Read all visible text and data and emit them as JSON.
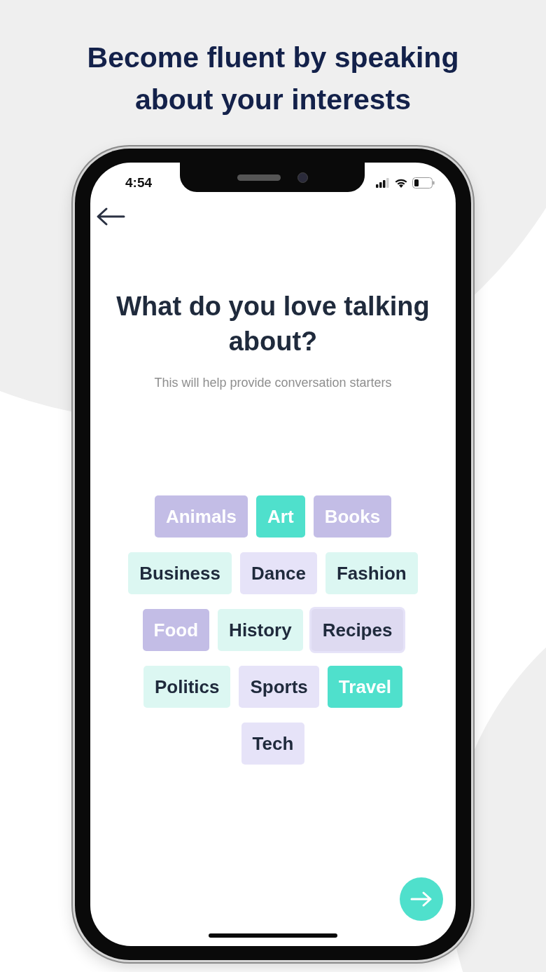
{
  "headline": "Become fluent by speaking about your interests",
  "status_bar": {
    "time": "4:54"
  },
  "question": {
    "title": "What do you love talking about?",
    "subtitle": "This will help provide conversation starters"
  },
  "topics": [
    {
      "label": "Animals",
      "color": "#c3bde6",
      "selected": true,
      "pressed": false
    },
    {
      "label": "Art",
      "color": "#4fe0cc",
      "selected": true,
      "pressed": false
    },
    {
      "label": "Books",
      "color": "#c3bde6",
      "selected": true,
      "pressed": false
    },
    {
      "label": "Business",
      "color": "#dcf7f2",
      "selected": false,
      "pressed": false
    },
    {
      "label": "Dance",
      "color": "#e6e3f8",
      "selected": false,
      "pressed": false
    },
    {
      "label": "Fashion",
      "color": "#dcf7f2",
      "selected": false,
      "pressed": false
    },
    {
      "label": "Food",
      "color": "#c3bde6",
      "selected": true,
      "pressed": false
    },
    {
      "label": "History",
      "color": "#dcf7f2",
      "selected": false,
      "pressed": false
    },
    {
      "label": "Recipes",
      "color": "#dedaf1",
      "selected": false,
      "pressed": true
    },
    {
      "label": "Politics",
      "color": "#dcf7f2",
      "selected": false,
      "pressed": false
    },
    {
      "label": "Sports",
      "color": "#e6e3f8",
      "selected": false,
      "pressed": false
    },
    {
      "label": "Travel",
      "color": "#4fe0cc",
      "selected": true,
      "pressed": false
    },
    {
      "label": "Tech",
      "color": "#e6e3f8",
      "selected": false,
      "pressed": false
    }
  ]
}
